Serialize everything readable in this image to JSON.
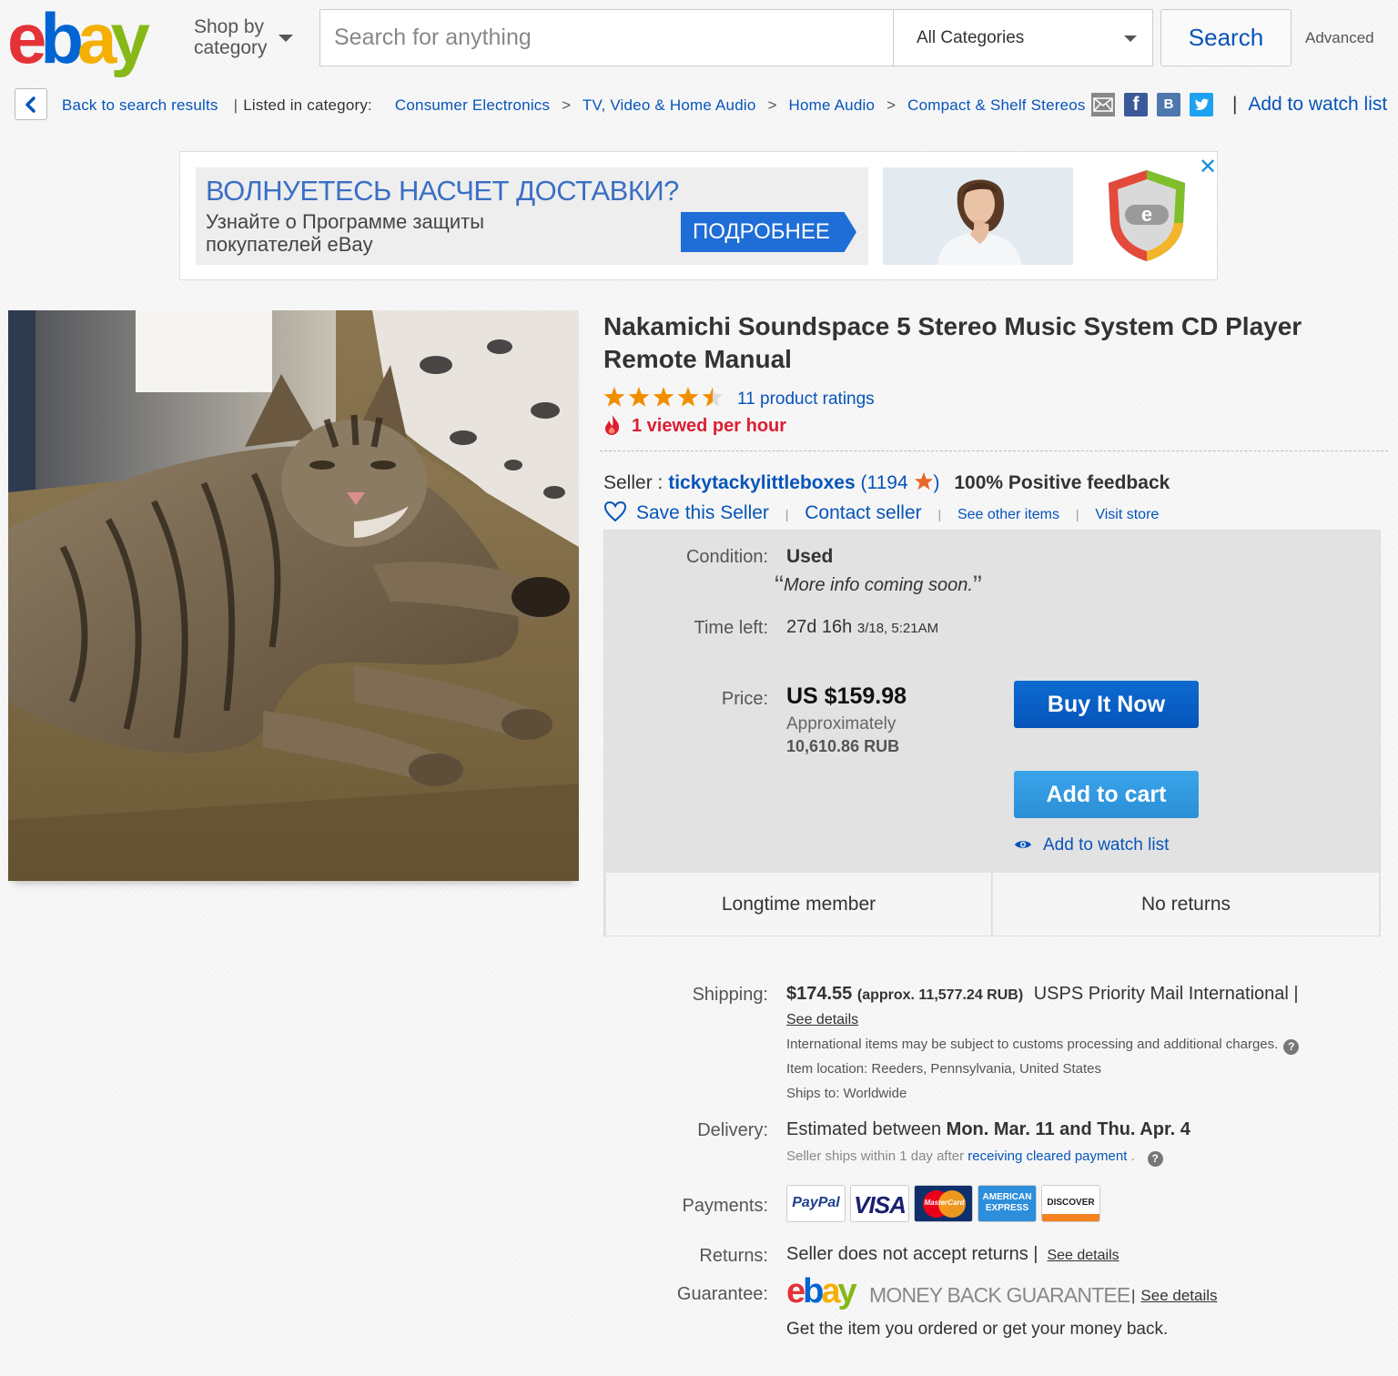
{
  "header": {
    "logo": {
      "e": "e",
      "b": "b",
      "a": "a",
      "y": "y"
    },
    "shop_by_category": "Shop by category",
    "search_placeholder": "Search for anything",
    "category_select": "All Categories",
    "search_button": "Search",
    "advanced_link": "Advanced"
  },
  "breadcrumb": {
    "back": "Back to search results",
    "listed_in": "Listed in category:",
    "items": [
      "Consumer Electronics",
      "TV, Video & Home Audio",
      "Home Audio",
      "Compact & Shelf Stereos"
    ],
    "separator": ">",
    "share_icons": [
      "mail-icon",
      "facebook-icon",
      "vk-icon",
      "twitter-icon"
    ],
    "share_glyphs": {
      "facebook": "f",
      "vk": "B"
    },
    "watch_pipe": "|",
    "watch_link": "Add to watch list"
  },
  "ad": {
    "headline": "ВОЛНУЕТЕСЬ НАСЧЕТ ДОСТАВКИ?",
    "subtext": "Узнайте о Программе защиты покупателей eBay",
    "cta": "ПОДРОБНЕЕ",
    "close": "✕",
    "shield_letter": "e"
  },
  "product": {
    "title": "Nakamichi Soundspace 5 Stereo Music System CD Player Remote Manual",
    "rating_stars": 4.5,
    "ratings_text": "11 product ratings",
    "viewed": "1 viewed per hour"
  },
  "seller": {
    "label": "Seller :",
    "name": "tickytackylittleboxes",
    "score_open": "(",
    "score": "1194",
    "score_close": ")",
    "positive": "100% Positive feedback",
    "save": "Save this Seller",
    "contact": "Contact seller",
    "other_items": "See other items",
    "visit_store": "Visit store",
    "pipe": "|"
  },
  "listing": {
    "condition_label": "Condition:",
    "condition": "Used",
    "condition_note": "More info coming soon.",
    "quote_open": "“",
    "quote_close": "”",
    "time_left_label": "Time left:",
    "time_left": "27d 16h",
    "end_time": "3/18, 5:21AM",
    "price_label": "Price:",
    "price": "US $159.98",
    "approx_label": "Approximately",
    "approx_value": "10,610.86 RUB",
    "buy_now": "Buy It Now",
    "add_to_cart": "Add to cart",
    "watch": "Add to watch list",
    "badge_member": "Longtime member",
    "badge_returns": "No returns"
  },
  "shipping": {
    "label": "Shipping:",
    "cost": "$174.55",
    "approx": "(approx. 11,577.24 RUB)",
    "service": "USPS Priority Mail International |",
    "details": "See details",
    "intl_note": "International items may be subject to customs processing and additional charges.",
    "location": "Item location:  Reeders, Pennsylvania, United States",
    "ships_to": "Ships to:  Worldwide",
    "help": "?"
  },
  "delivery": {
    "label": "Delivery:",
    "prefix": "Estimated between",
    "range": "Mon. Mar. 11 and Thu. Apr. 4",
    "sub_prefix": "Seller ships within 1 day after",
    "sub_link": "receiving cleared payment",
    "sub_suffix": "."
  },
  "payments": {
    "label": "Payments:",
    "methods": [
      "PayPal",
      "VISA",
      "MasterCard",
      "AMERICAN EXPRESS",
      "DISCOVER"
    ]
  },
  "returns": {
    "label": "Returns:",
    "text": "Seller does not accept returns |",
    "details": "See details"
  },
  "guarantee": {
    "label": "Guarantee:",
    "logo": {
      "e": "e",
      "b": "b",
      "a": "a",
      "y": "y"
    },
    "text": "MONEY BACK GUARANTEE",
    "pipe": "|",
    "details": "See details",
    "note": "Get the item you ordered or get your money back."
  },
  "colors": {
    "link": "#0654ba",
    "buy_button": "#0654ba",
    "cart_button": "#3aa4ea",
    "viewed_red": "#dd1e31",
    "star_orange": "#f18e00"
  }
}
